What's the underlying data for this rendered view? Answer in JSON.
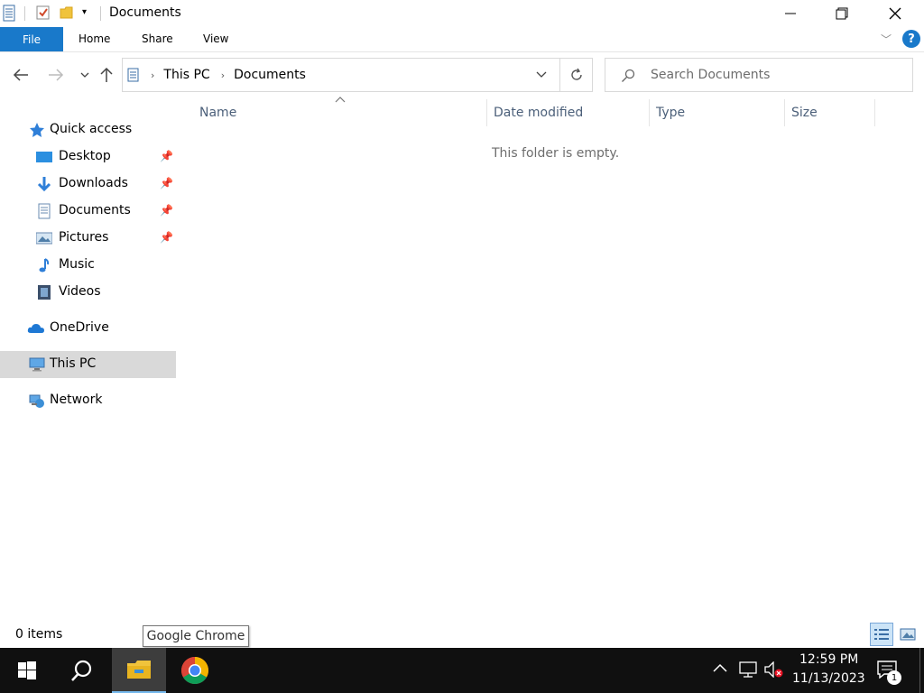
{
  "window": {
    "title": "Documents"
  },
  "ribbon": {
    "tabs": [
      "File",
      "Home",
      "Share",
      "View"
    ]
  },
  "address": {
    "crumbs": [
      "This PC",
      "Documents"
    ]
  },
  "search": {
    "placeholder": "Search Documents"
  },
  "sidebar": {
    "quick_access": "Quick access",
    "items": [
      {
        "label": "Desktop",
        "icon": "desktop-icon",
        "pinned": true
      },
      {
        "label": "Downloads",
        "icon": "downloads-icon",
        "pinned": true
      },
      {
        "label": "Documents",
        "icon": "documents-icon",
        "pinned": true
      },
      {
        "label": "Pictures",
        "icon": "pictures-icon",
        "pinned": true
      },
      {
        "label": "Music",
        "icon": "music-icon",
        "pinned": false
      },
      {
        "label": "Videos",
        "icon": "videos-icon",
        "pinned": false
      }
    ],
    "onedrive": "OneDrive",
    "this_pc": "This PC",
    "network": "Network"
  },
  "columns": [
    "Name",
    "Date modified",
    "Type",
    "Size"
  ],
  "content": {
    "empty_message": "This folder is empty."
  },
  "status": {
    "item_count": "0 items"
  },
  "tooltip": {
    "text": "Google Chrome"
  },
  "taskbar": {
    "time": "12:59 PM",
    "date": "11/13/2023",
    "notification_count": "1"
  },
  "colors": {
    "accent": "#1979ca",
    "selected": "#d9d9d9",
    "taskbar": "#101010"
  }
}
